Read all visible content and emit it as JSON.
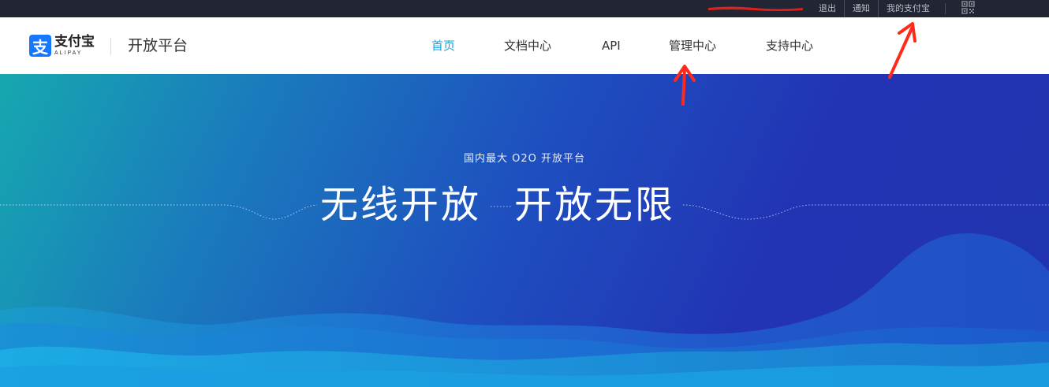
{
  "topbar": {
    "links": [
      {
        "label": "退出"
      },
      {
        "label": "通知"
      },
      {
        "label": "我的支付宝"
      }
    ]
  },
  "header": {
    "logo": {
      "badge": "支",
      "name_cn": "支付宝",
      "name_en": "ALIPAY"
    },
    "platform_title": "开放平台",
    "nav": [
      {
        "label": "首页",
        "active": true
      },
      {
        "label": "文档中心",
        "active": false
      },
      {
        "label": "API",
        "active": false
      },
      {
        "label": "管理中心",
        "active": false
      },
      {
        "label": "支持中心",
        "active": false
      }
    ]
  },
  "hero": {
    "subtitle": "国内最大 O2O 开放平台",
    "slogan_left": "无线开放",
    "slogan_right": "开放无限"
  },
  "colors": {
    "topbar": "#222634",
    "nav_active": "#1aa3d8",
    "hero_start": "#16a8b0",
    "hero_end": "#2135ae",
    "annotation": "#ff2a1a",
    "logo_blue": "#1677ff"
  },
  "icons": [
    "qr-code-icon",
    "alipay-logo-icon"
  ]
}
